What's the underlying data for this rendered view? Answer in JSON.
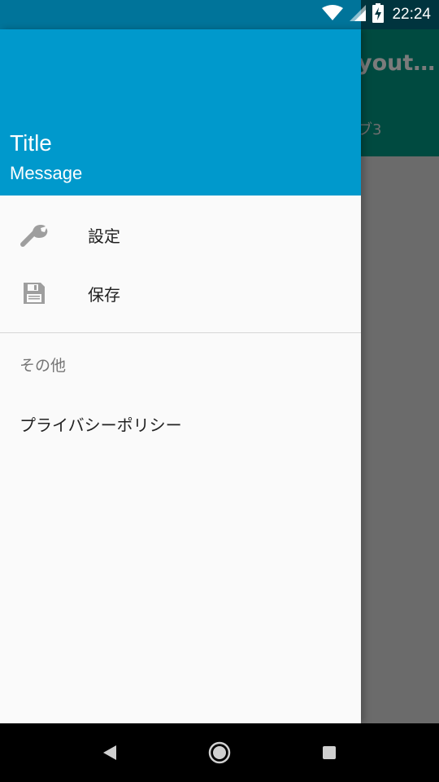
{
  "status_bar": {
    "time": "22:24",
    "icons": [
      "wifi-icon",
      "signal-icon",
      "battery-charging-icon"
    ]
  },
  "background_app": {
    "title": "yout…",
    "tab": "ブ3"
  },
  "drawer": {
    "header": {
      "title": "Title",
      "message": "Message"
    },
    "items": [
      {
        "label": "設定",
        "icon": "wrench-icon"
      },
      {
        "label": "保存",
        "icon": "save-icon"
      }
    ],
    "section": {
      "header": "その他",
      "items": [
        {
          "label": "プライバシーポリシー"
        }
      ]
    }
  },
  "nav_bar": {
    "buttons": [
      "back-icon",
      "home-icon",
      "recents-icon"
    ]
  },
  "colors": {
    "header": "#0099cc",
    "status_bar": "#00749a",
    "drawer_bg": "#fafafa",
    "icon": "#9e9e9e"
  }
}
